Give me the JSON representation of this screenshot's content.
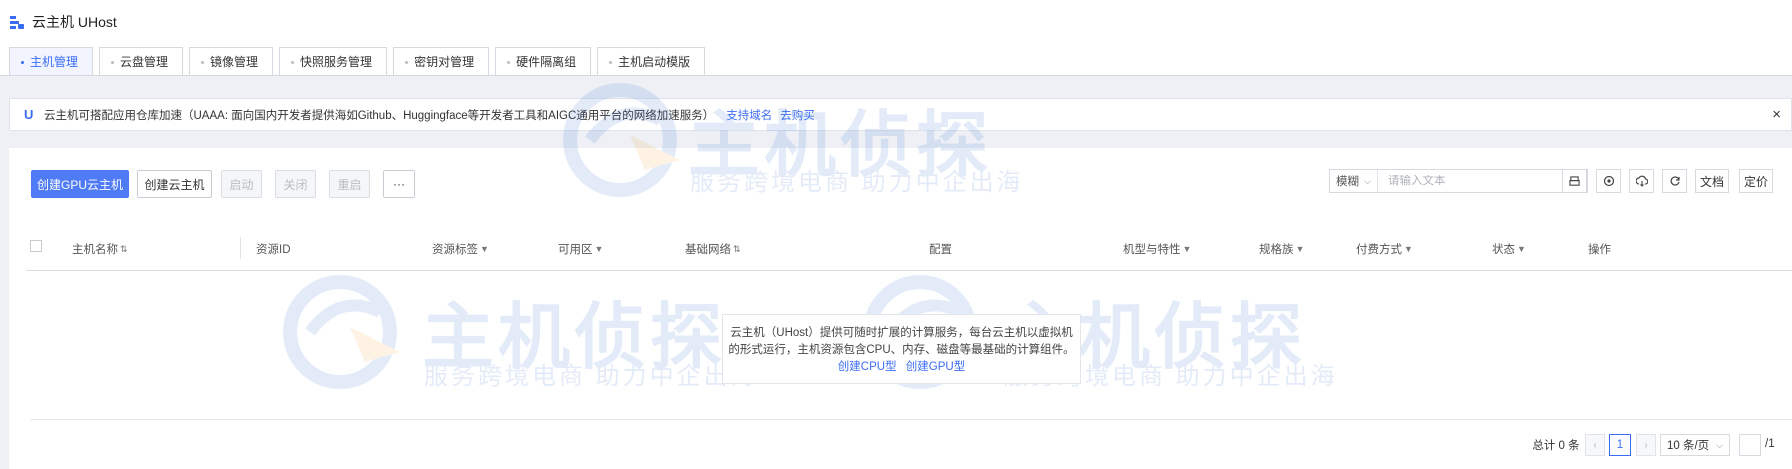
{
  "app": {
    "title": "云主机 UHost",
    "icon": "uhost-logo-icon"
  },
  "tabs": [
    {
      "label": "主机管理",
      "active": true
    },
    {
      "label": "云盘管理",
      "active": false
    },
    {
      "label": "镜像管理",
      "active": false
    },
    {
      "label": "快照服务管理",
      "active": false
    },
    {
      "label": "密钥对管理",
      "active": false
    },
    {
      "label": "硬件隔离组",
      "active": false
    },
    {
      "label": "主机启动模版",
      "active": false
    }
  ],
  "notice": {
    "icon": "uaaa-icon",
    "text": "云主机可搭配应用仓库加速（UAAA: 面向国内开发者提供海如Github、Huggingface等开发者工具和AIGC通用平台的网络加速服务）",
    "link_domains": "支持域名",
    "link_buy": "去购买",
    "close": "×"
  },
  "toolbar": {
    "create_gpu": "创建GPU云主机",
    "create_host": "创建云主机",
    "start": "启动",
    "stop": "关闭",
    "restart": "重启",
    "more": "···"
  },
  "search": {
    "mode": "模糊",
    "placeholder": "请输入文本",
    "search_icon": "search-icon"
  },
  "tools": {
    "export_icon": "print-icon",
    "settings_icon": "eye-settings-icon",
    "sync_icon": "cloud-sync-icon",
    "refresh_icon": "refresh-icon",
    "docs": "文档",
    "pricing": "定价"
  },
  "table": {
    "columns": [
      {
        "label": "主机名称",
        "icon": "sort"
      },
      {
        "label": "资源ID",
        "icon": ""
      },
      {
        "label": "资源标签",
        "icon": "filter"
      },
      {
        "label": "可用区",
        "icon": "filter"
      },
      {
        "label": "基础网络",
        "icon": "sort"
      },
      {
        "label": "配置",
        "icon": ""
      },
      {
        "label": "机型与特性",
        "icon": "filter"
      },
      {
        "label": "规格族",
        "icon": "filter"
      },
      {
        "label": "付费方式",
        "icon": "filter"
      },
      {
        "label": "状态",
        "icon": "filter"
      },
      {
        "label": "操作",
        "icon": ""
      }
    ],
    "empty": {
      "line1": "云主机（UHost）提供可随时扩展的计算服务，每台云主机以虚拟机",
      "line2": "的形式运行，主机资源包含CPU、内存、磁盘等最基础的计算组件。",
      "link_cpu": "创建CPU型",
      "link_gpu": "创建GPU型"
    }
  },
  "pagination": {
    "total": "总计 0 条",
    "prev": "‹",
    "current": "1",
    "next": "›",
    "page_size": "10 条/页",
    "total_pages": "/1"
  },
  "watermark": {
    "title": "主机侦探",
    "subtitle": "服务跨境电商 助力中企出海"
  }
}
